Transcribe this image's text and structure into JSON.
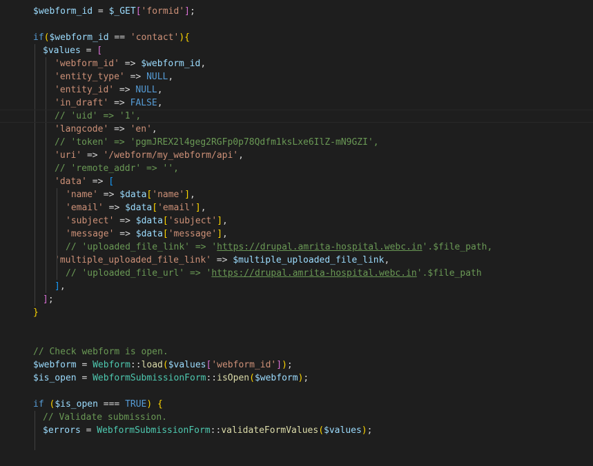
{
  "editor": {
    "language": "php",
    "theme": "dark",
    "colors": {
      "background": "#1e1e1e",
      "variable": "#9cdcfe",
      "string": "#ce9178",
      "keyword": "#569cd6",
      "operator": "#d4d4d4",
      "comment": "#6a9955",
      "function": "#dcdcaa",
      "class": "#4ec9b0",
      "bracket_gold": "#ffd700",
      "bracket_orchid": "#da70d6",
      "bracket_blue": "#179fff"
    },
    "lines": [
      {
        "tokens": [
          [
            "$webform_id",
            "v"
          ],
          [
            " = ",
            "op"
          ],
          [
            "$_GET",
            "v"
          ],
          [
            "[",
            "b2"
          ],
          [
            "'formid'",
            "s"
          ],
          [
            "]",
            "b2"
          ],
          [
            ";",
            "op"
          ]
        ]
      },
      {
        "tokens": []
      },
      {
        "tokens": [
          [
            "if",
            "k"
          ],
          [
            "(",
            "b1"
          ],
          [
            "$webform_id",
            "v"
          ],
          [
            " == ",
            "op"
          ],
          [
            "'contact'",
            "s"
          ],
          [
            ")",
            "b1"
          ],
          [
            "{",
            "b1"
          ]
        ]
      },
      {
        "tokens": [
          [
            "$values",
            "v"
          ],
          [
            " = ",
            "op"
          ],
          [
            "[",
            "b2"
          ]
        ]
      },
      {
        "tokens": [
          [
            "'webform_id'",
            "s"
          ],
          [
            " => ",
            "op"
          ],
          [
            "$webform_id",
            "v"
          ],
          [
            ",",
            "op"
          ]
        ]
      },
      {
        "tokens": [
          [
            "'entity_type'",
            "s"
          ],
          [
            " => ",
            "op"
          ],
          [
            "NULL",
            "k"
          ],
          [
            ",",
            "op"
          ]
        ]
      },
      {
        "tokens": [
          [
            "'entity_id'",
            "s"
          ],
          [
            " => ",
            "op"
          ],
          [
            "NULL",
            "k"
          ],
          [
            ",",
            "op"
          ]
        ]
      },
      {
        "tokens": [
          [
            "'in_draft'",
            "s"
          ],
          [
            " => ",
            "op"
          ],
          [
            "FALSE",
            "k"
          ],
          [
            ",",
            "op"
          ]
        ]
      },
      {
        "tokens": [
          [
            "// 'uid' => '1',",
            "c"
          ]
        ],
        "current": true
      },
      {
        "tokens": [
          [
            "'langcode'",
            "s"
          ],
          [
            " => ",
            "op"
          ],
          [
            "'en'",
            "s"
          ],
          [
            ",",
            "op"
          ]
        ]
      },
      {
        "tokens": [
          [
            "// 'token' => 'pgmJREX2l4geg2RGFp0p78Qdfm1ksLxe6IlZ-mN9GZI',",
            "c"
          ]
        ]
      },
      {
        "tokens": [
          [
            "'uri'",
            "s"
          ],
          [
            " => ",
            "op"
          ],
          [
            "'/webform/my_webform/api'",
            "s"
          ],
          [
            ",",
            "op"
          ]
        ]
      },
      {
        "tokens": [
          [
            "// 'remote_addr' => '',",
            "c"
          ]
        ]
      },
      {
        "tokens": [
          [
            "'data'",
            "s"
          ],
          [
            " => ",
            "op"
          ],
          [
            "[",
            "b3"
          ]
        ]
      },
      {
        "tokens": [
          [
            "'name'",
            "s"
          ],
          [
            " => ",
            "op"
          ],
          [
            "$data",
            "v"
          ],
          [
            "[",
            "b1"
          ],
          [
            "'name'",
            "s"
          ],
          [
            "]",
            "b1"
          ],
          [
            ",",
            "op"
          ]
        ]
      },
      {
        "tokens": [
          [
            "'email'",
            "s"
          ],
          [
            " => ",
            "op"
          ],
          [
            "$data",
            "v"
          ],
          [
            "[",
            "b1"
          ],
          [
            "'email'",
            "s"
          ],
          [
            "]",
            "b1"
          ],
          [
            ",",
            "op"
          ]
        ]
      },
      {
        "tokens": [
          [
            "'subject'",
            "s"
          ],
          [
            " => ",
            "op"
          ],
          [
            "$data",
            "v"
          ],
          [
            "[",
            "b1"
          ],
          [
            "'subject'",
            "s"
          ],
          [
            "]",
            "b1"
          ],
          [
            ",",
            "op"
          ]
        ]
      },
      {
        "tokens": [
          [
            "'message'",
            "s"
          ],
          [
            " => ",
            "op"
          ],
          [
            "$data",
            "v"
          ],
          [
            "[",
            "b1"
          ],
          [
            "'message'",
            "s"
          ],
          [
            "]",
            "b1"
          ],
          [
            ",",
            "op"
          ]
        ]
      },
      {
        "tokens": [
          [
            "// 'uploaded_file_link' => '",
            "c"
          ],
          [
            "https://drupal.amrita-hospital.webc.in",
            "c u"
          ],
          [
            "'.$file_path,",
            "c"
          ]
        ]
      },
      {
        "tokens": [
          [
            "'multiple_uploaded_file_link'",
            "s"
          ],
          [
            " => ",
            "op"
          ],
          [
            "$multiple_uploaded_file_link",
            "v"
          ],
          [
            ",",
            "op"
          ]
        ]
      },
      {
        "tokens": [
          [
            "// 'uploaded_file_url' => '",
            "c"
          ],
          [
            "https://drupal.amrita-hospital.webc.in",
            "c u"
          ],
          [
            "'.$file_path",
            "c"
          ]
        ]
      },
      {
        "tokens": [
          [
            "]",
            "b3"
          ],
          [
            ",",
            "op"
          ]
        ]
      },
      {
        "tokens": [
          [
            "]",
            "b2"
          ],
          [
            ";",
            "op"
          ]
        ]
      },
      {
        "tokens": [
          [
            "}",
            "b1"
          ]
        ]
      },
      {
        "tokens": []
      },
      {
        "tokens": []
      },
      {
        "tokens": [
          [
            "// Check webform is open.",
            "c"
          ]
        ]
      },
      {
        "tokens": [
          [
            "$webform",
            "v"
          ],
          [
            " = ",
            "op"
          ],
          [
            "Webform",
            "cl"
          ],
          [
            "::",
            "op"
          ],
          [
            "load",
            "f"
          ],
          [
            "(",
            "b1"
          ],
          [
            "$values",
            "v"
          ],
          [
            "[",
            "b2"
          ],
          [
            "'webform_id'",
            "s"
          ],
          [
            "]",
            "b2"
          ],
          [
            ")",
            "b1"
          ],
          [
            ";",
            "op"
          ]
        ]
      },
      {
        "tokens": [
          [
            "$is_open",
            "v"
          ],
          [
            " = ",
            "op"
          ],
          [
            "WebformSubmissionForm",
            "cl"
          ],
          [
            "::",
            "op"
          ],
          [
            "isOpen",
            "f"
          ],
          [
            "(",
            "b1"
          ],
          [
            "$webform",
            "v"
          ],
          [
            ")",
            "b1"
          ],
          [
            ";",
            "op"
          ]
        ]
      },
      {
        "tokens": []
      },
      {
        "tokens": [
          [
            "if",
            "k"
          ],
          [
            " ",
            "op"
          ],
          [
            "(",
            "b1"
          ],
          [
            "$is_open",
            "v"
          ],
          [
            " === ",
            "op"
          ],
          [
            "TRUE",
            "k"
          ],
          [
            ")",
            "b1"
          ],
          [
            " ",
            "op"
          ],
          [
            "{",
            "b1"
          ]
        ]
      },
      {
        "tokens": [
          [
            "// Validate submission.",
            "c"
          ]
        ]
      },
      {
        "tokens": [
          [
            "$errors",
            "v"
          ],
          [
            " = ",
            "op"
          ],
          [
            "WebformSubmissionForm",
            "cl"
          ],
          [
            "::",
            "op"
          ],
          [
            "validateFormValues",
            "f"
          ],
          [
            "(",
            "b1"
          ],
          [
            "$values",
            "v"
          ],
          [
            ")",
            "b1"
          ],
          [
            ";",
            "op"
          ]
        ]
      },
      {
        "tokens": []
      }
    ]
  }
}
